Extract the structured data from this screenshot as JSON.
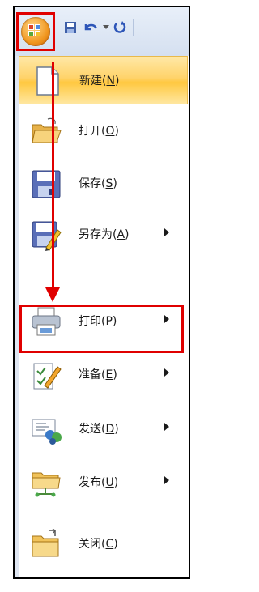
{
  "menu": {
    "items": [
      {
        "label": "新建",
        "shortcut": "N",
        "icon": "new-document-icon",
        "has_submenu": false
      },
      {
        "label": "打开",
        "shortcut": "O",
        "icon": "open-folder-icon",
        "has_submenu": false
      },
      {
        "label": "保存",
        "shortcut": "S",
        "icon": "save-icon",
        "has_submenu": false
      },
      {
        "label": "另存为",
        "shortcut": "A",
        "icon": "save-as-icon",
        "has_submenu": true
      },
      {
        "label": "打印",
        "shortcut": "P",
        "icon": "printer-icon",
        "has_submenu": true
      },
      {
        "label": "准备",
        "shortcut": "E",
        "icon": "prepare-icon",
        "has_submenu": true
      },
      {
        "label": "发送",
        "shortcut": "D",
        "icon": "send-icon",
        "has_submenu": true
      },
      {
        "label": "发布",
        "shortcut": "U",
        "icon": "publish-icon",
        "has_submenu": true
      },
      {
        "label": "关闭",
        "shortcut": "C",
        "icon": "close-folder-icon",
        "has_submenu": false
      }
    ],
    "active_index": 0,
    "highlighted_index": 4
  },
  "colors": {
    "annotation": "#e00000",
    "hover": "#ffd36a"
  }
}
